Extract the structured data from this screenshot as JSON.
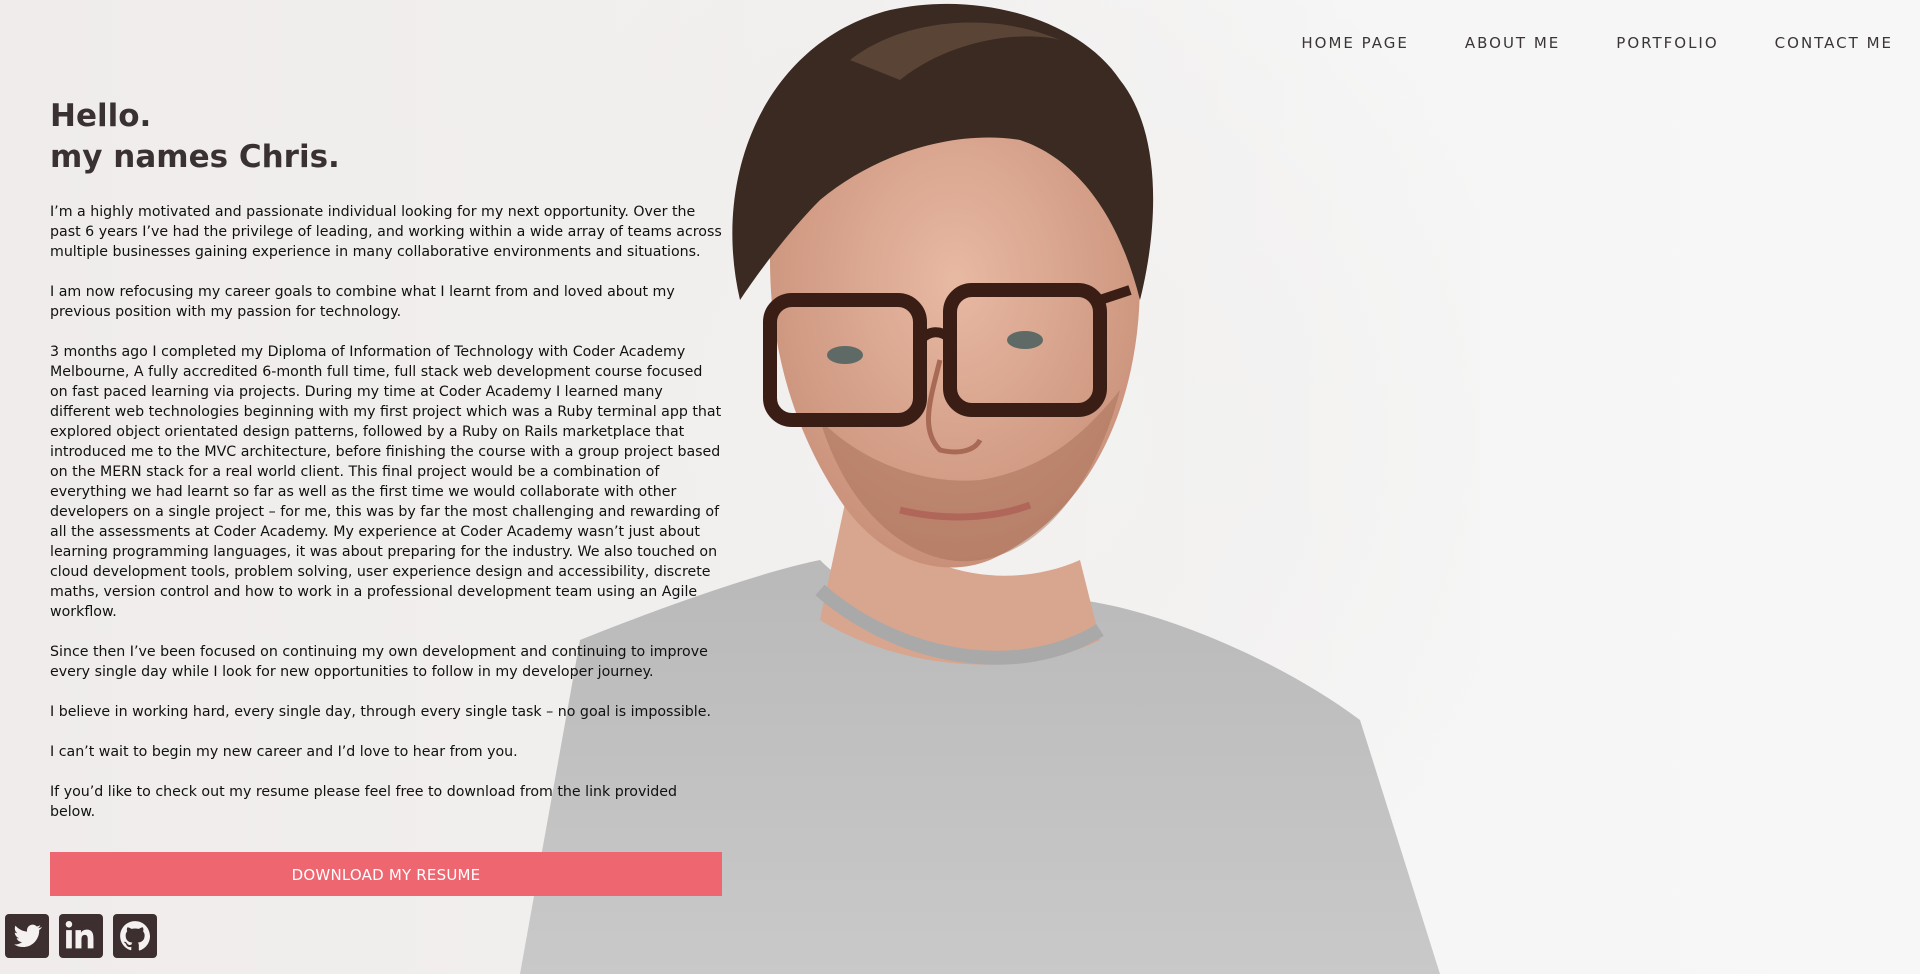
{
  "nav": {
    "items": [
      {
        "label": "HOME PAGE"
      },
      {
        "label": "ABOUT ME"
      },
      {
        "label": "PORTFOLIO"
      },
      {
        "label": "CONTACT ME"
      }
    ]
  },
  "hero": {
    "greeting_line1": "Hello.",
    "greeting_line2": "my names Chris.",
    "paragraphs": [
      "I’m a highly motivated and passionate individual looking for my next opportunity. Over the past 6 years I’ve had the privilege of leading, and working within a wide array of teams across multiple businesses gaining experience in many collaborative environments and situations.",
      "I am now refocusing my career goals to combine what I learnt from and loved about my previous position with my passion for technology.",
      "3 months ago I completed my Diploma of Information of Technology with Coder Academy Melbourne, A fully accredited 6-month full time, full stack web development course focused on fast paced learning via projects. During my time at Coder Academy I learned many different web technologies beginning with my first project which was a Ruby terminal app that explored object orientated design patterns, followed by a Ruby on Rails marketplace that introduced me to the MVC architecture, before finishing the course with a group project based on the MERN stack for a real world client. This final project would be a combination of everything we had learnt so far as well as the first time we would collaborate with other developers on a single project – for me, this was by far the most challenging and rewarding of all the assessments at Coder Academy. My experience at Coder Academy wasn’t just about learning programming languages, it was about preparing for the industry. We also touched on cloud development tools, problem solving, user experience design and accessibility, discrete maths, version control and how to work in a professional development team using an Agile workflow.",
      "Since then I’ve been focused on continuing my own development and continuing to improve every single day while I look for new opportunities to follow in my developer journey.",
      "I believe in working hard, every single day, through every single task – no goal is impossible.",
      "I can’t wait to begin my new career and I’d love to hear from you.",
      "If you’d like to check out my resume please feel free to download from the link provided below."
    ],
    "resume_button": "DOWNLOAD MY RESUME"
  },
  "social": {
    "icons": [
      "twitter-icon",
      "linkedin-icon",
      "github-icon"
    ]
  },
  "colors": {
    "accent": "#ee6670",
    "icon_bg": "#3d2f2f",
    "heading": "#3a3232"
  }
}
